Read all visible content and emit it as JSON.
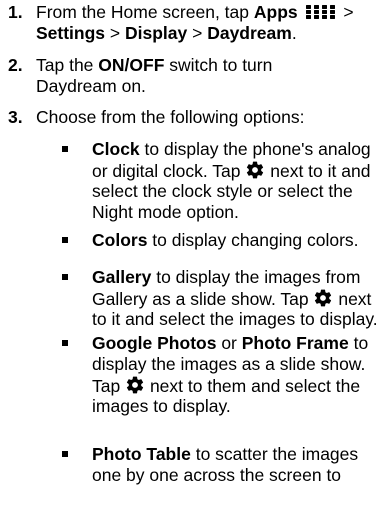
{
  "steps": [
    {
      "num": "1.",
      "line1": {
        "pre": "From the Home screen, tap ",
        "apps": "Apps",
        "post": " >"
      },
      "line2": {
        "settings": "Settings",
        "sep1": " > ",
        "display": "Display",
        "sep2": " > ",
        "daydream": "Daydream",
        "end": "."
      }
    },
    {
      "num": "2.",
      "line1": {
        "pre": "Tap the ",
        "bold": "ON/OFF",
        "post": " switch to turn"
      },
      "line2": "Daydream on."
    },
    {
      "num": "3.",
      "line1": "Choose from the following options:"
    }
  ],
  "options": [
    {
      "title": "Clock",
      "t1": " to display the phone's analog",
      "l2": "or digital clock. Tap ",
      "l2b": " next to it and",
      "l3": "select the clock style or select the",
      "l4": "Night mode option."
    },
    {
      "title": "Colors",
      "t1": " to display changing colors."
    },
    {
      "title": "Gallery",
      "t1": " to display the images from",
      "l2": "Gallery as a slide show. Tap ",
      "l2b": " next",
      "l3": "to it and select the images to display."
    },
    {
      "title": "Google Photos",
      "or": " or ",
      "title2": "Photo Frame",
      "t1": " to",
      "l2": "display the images as a slide show.",
      "l3": "Tap ",
      "l3b": " next to them and select the",
      "l4": "images to display."
    },
    {
      "title": "Photo Table",
      "t1": " to scatter the images",
      "l2": "one by one across the screen to"
    }
  ],
  "icons": {
    "apps": "apps-grid-icon",
    "settings": "gear-icon",
    "color": "#000000"
  }
}
